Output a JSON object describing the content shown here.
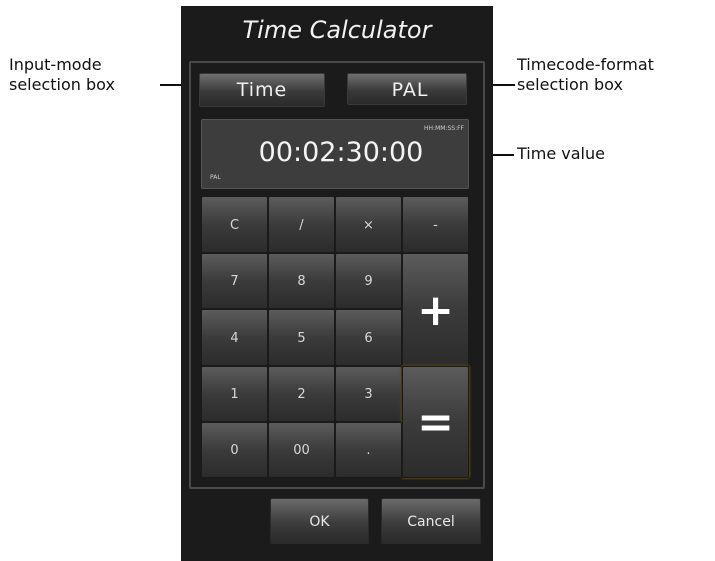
{
  "callouts": {
    "input_mode": [
      "Input-mode",
      "selection box"
    ],
    "timecode_format": [
      "Timecode-format",
      "selection box"
    ],
    "time_value": "Time value"
  },
  "calculator": {
    "title": "Time Calculator",
    "input_mode": "Time",
    "timecode_format": "PAL",
    "display": {
      "value": "00:02:30:00",
      "format_hint": "HH:MM:SS:FF",
      "format_tag": "PAL"
    },
    "keypad": {
      "clear": "C",
      "divide": "/",
      "multiply": "×",
      "minus": "-",
      "plus": "+",
      "equals": "=",
      "digits": [
        "0",
        "1",
        "2",
        "3",
        "4",
        "5",
        "6",
        "7",
        "8",
        "9"
      ],
      "double_zero": "00",
      "decimal": "."
    },
    "ok": "OK",
    "cancel": "Cancel"
  },
  "colors": {
    "panel": "#1b1b1b",
    "key": "#3b3b3b",
    "text": "#f2f2f2",
    "equals_glow": "#5a4a10"
  }
}
